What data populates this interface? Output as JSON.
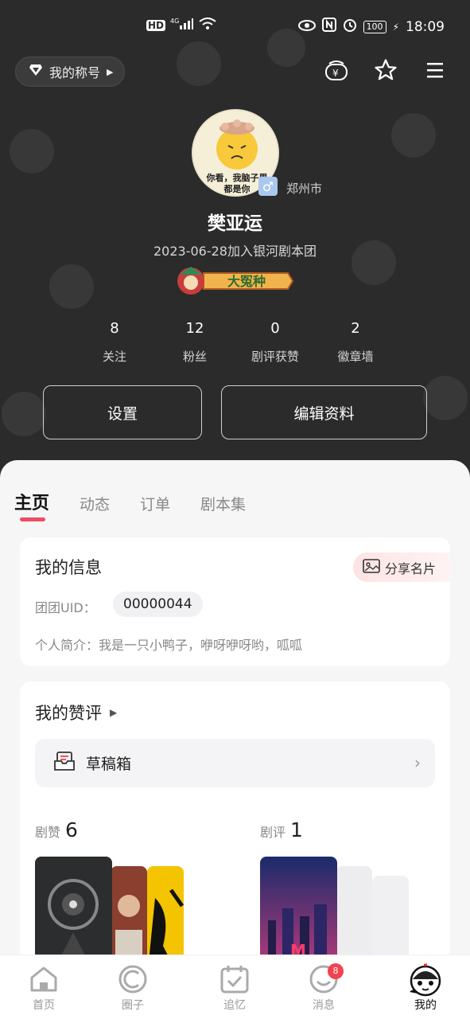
{
  "status_bar": {
    "left_text": "HD 4G",
    "battery": "100",
    "time": "18:09"
  },
  "header": {
    "title_pill": "我的称号"
  },
  "profile": {
    "avatar_caption_1": "你看，我脑子里",
    "avatar_caption_2": "都是你",
    "gender_symbol": "♂",
    "city": "郑州市",
    "name": "樊亚运",
    "joined": "2023-06-28加入银河剧本团",
    "badge_text": "大冤种"
  },
  "stats": [
    {
      "num": "8",
      "label": "关注"
    },
    {
      "num": "12",
      "label": "粉丝"
    },
    {
      "num": "0",
      "label": "剧评获赞"
    },
    {
      "num": "2",
      "label": "徽章墙"
    }
  ],
  "buttons": {
    "settings": "设置",
    "edit": "编辑资料"
  },
  "tabs": [
    "主页",
    "动态",
    "订单",
    "剧本集"
  ],
  "info_card": {
    "title": "我的信息",
    "share": "分享名片",
    "uid_label": "团团UID：",
    "uid_value": "00000044",
    "bio": "个人简介：我是一只小鸭子，咿呀咿呀哟，呱呱"
  },
  "likes_card": {
    "title": "我的赞评",
    "drafts": "草稿箱",
    "likes_label": "剧赞",
    "likes_count": "6",
    "reviews_label": "剧评",
    "reviews_count": "1"
  },
  "nav": [
    {
      "label": "首页",
      "icon": "home-icon"
    },
    {
      "label": "圈子",
      "icon": "circle-icon"
    },
    {
      "label": "追忆",
      "icon": "calendar-icon"
    },
    {
      "label": "消息",
      "icon": "message-icon",
      "badge": "8"
    },
    {
      "label": "我的",
      "icon": "mascot-icon"
    }
  ],
  "colors": {
    "hero_bg": "#2b2b2b",
    "accent": "#ee4d62",
    "badge_red": "#f2434f"
  }
}
